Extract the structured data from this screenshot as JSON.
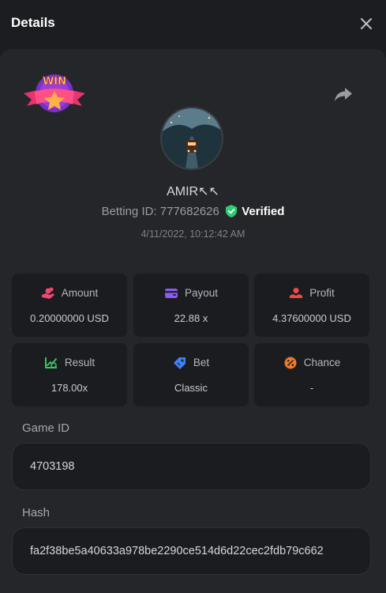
{
  "header": {
    "title": "Details"
  },
  "profile": {
    "username": "AMIR↖↖",
    "betting_id_label": "Betting ID: 777682626",
    "verified_label": "Verified",
    "date": "4/11/2022, 10:12:42 AM"
  },
  "badge": {
    "text": "WIN"
  },
  "stats": [
    {
      "label": "Amount",
      "value": "0.20000000 USD",
      "icon": "coins-hand-icon"
    },
    {
      "label": "Payout",
      "value": "22.88 x",
      "icon": "wallet-icon"
    },
    {
      "label": "Profit",
      "value": "4.37600000 USD",
      "icon": "profit-hand-icon"
    },
    {
      "label": "Result",
      "value": "178.00x",
      "icon": "growth-chart-icon"
    },
    {
      "label": "Bet",
      "value": "Classic",
      "icon": "tag-icon"
    },
    {
      "label": "Chance",
      "value": "-",
      "icon": "percent-icon"
    }
  ],
  "game_id": {
    "label": "Game ID",
    "value": "4703198"
  },
  "hash": {
    "label": "Hash",
    "value": "fa2f38be5a40633a978be2290ce514d6d22cec2fdb79c662"
  },
  "colors": {
    "amount": "#ec4a6f",
    "payout": "#8a5cf6",
    "profit": "#ef4a4a",
    "result": "#3ec25a",
    "bet": "#3b82f6",
    "chance": "#f07a2a",
    "verified": "#2ecc71"
  }
}
